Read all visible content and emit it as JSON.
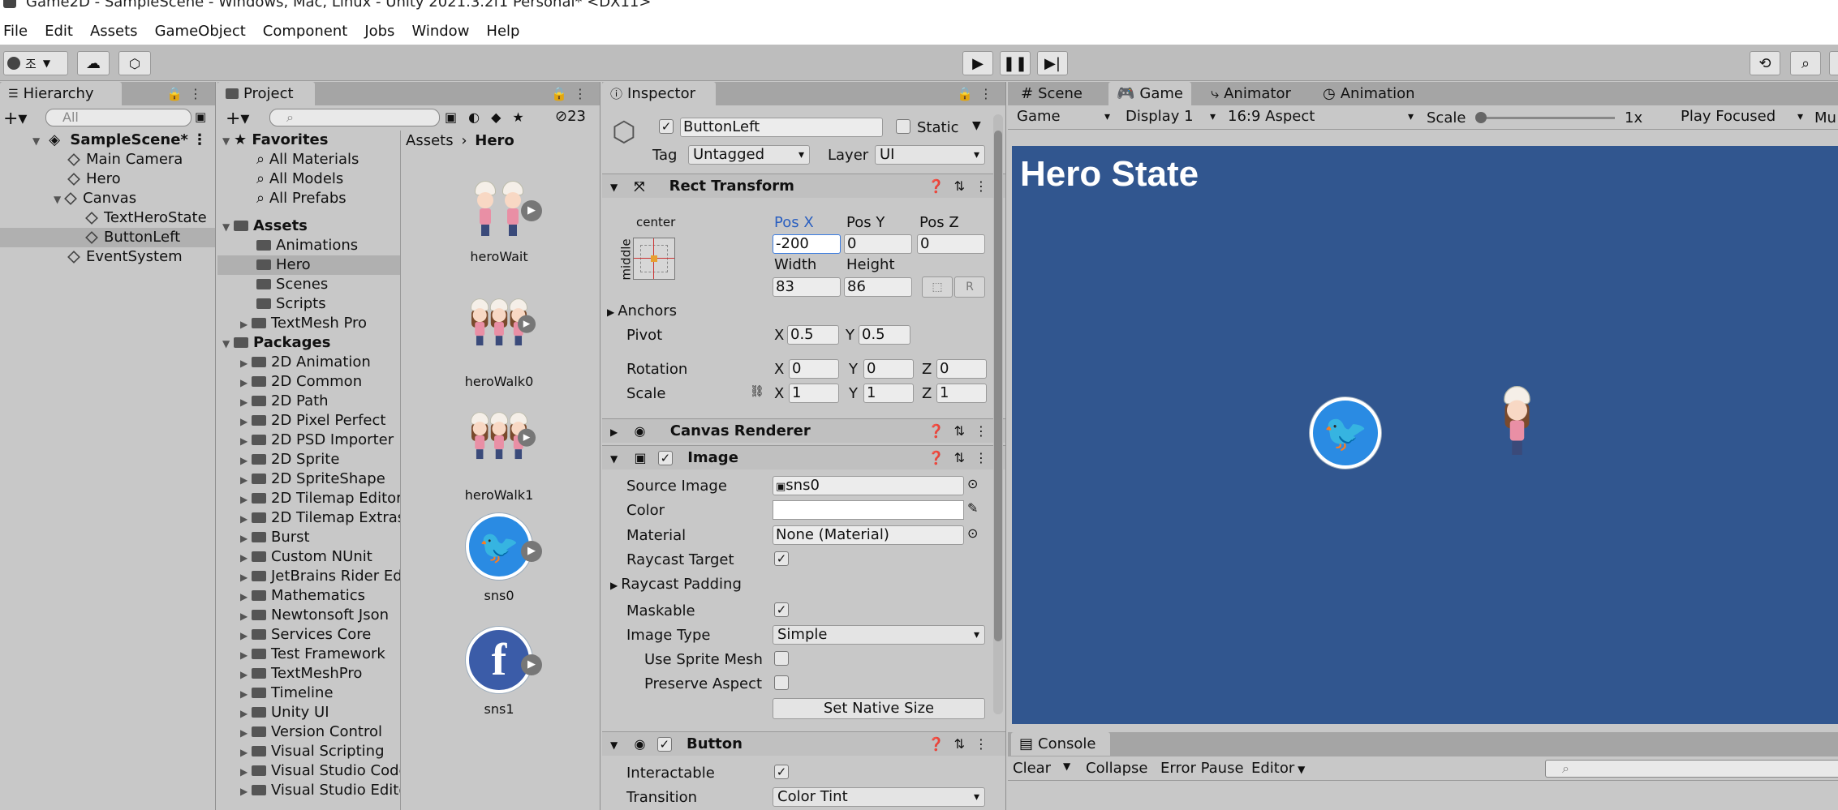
{
  "window": {
    "title": "Game2D - SampleScene - Windows, Mac, Linux - Unity 2021.3.2f1 Personal* <DX11>"
  },
  "menu": [
    "File",
    "Edit",
    "Assets",
    "GameObject",
    "Component",
    "Jobs",
    "Window",
    "Help"
  ],
  "toolbar": {
    "account_label": "조"
  },
  "hierarchy": {
    "tab": "Hierarchy",
    "search_placeholder": "All",
    "scene": "SampleScene*",
    "items": [
      "Main Camera",
      "Hero",
      "Canvas",
      "TextHeroState",
      "ButtonLeft",
      "EventSystem"
    ]
  },
  "project": {
    "tab": "Project",
    "hidden_count": "23",
    "favorites": {
      "title": "Favorites",
      "items": [
        "All Materials",
        "All Models",
        "All Prefabs"
      ]
    },
    "assets": {
      "title": "Assets",
      "items": [
        "Animations",
        "Hero",
        "Scenes",
        "Scripts",
        "TextMesh Pro"
      ]
    },
    "packages": {
      "title": "Packages",
      "items": [
        "2D Animation",
        "2D Common",
        "2D Path",
        "2D Pixel Perfect",
        "2D PSD Importer",
        "2D Sprite",
        "2D SpriteShape",
        "2D Tilemap Editor",
        "2D Tilemap Extras",
        "Burst",
        "Custom NUnit",
        "JetBrains Rider Editor",
        "Mathematics",
        "Newtonsoft Json",
        "Services Core",
        "Test Framework",
        "TextMeshPro",
        "Timeline",
        "Unity UI",
        "Version Control",
        "Visual Scripting",
        "Visual Studio Code Editor",
        "Visual Studio Editor"
      ]
    },
    "breadcrumb": [
      "Assets",
      "Hero"
    ],
    "grid": [
      "heroWait",
      "heroWalk0",
      "heroWalk1",
      "sns0",
      "sns1"
    ]
  },
  "inspector": {
    "tab": "Inspector",
    "object_name": "ButtonLeft",
    "static_label": "Static",
    "tag_label": "Tag",
    "tag_value": "Untagged",
    "layer_label": "Layer",
    "layer_value": "UI",
    "rect": {
      "title": "Rect Transform",
      "anchor_h": "center",
      "anchor_v": "middle",
      "posx_label": "Pos X",
      "posy_label": "Pos Y",
      "posz_label": "Pos Z",
      "posx": "-200",
      "posy": "0",
      "posz": "0",
      "width_label": "Width",
      "height_label": "Height",
      "width": "83",
      "height": "86",
      "anchors": "Anchors",
      "pivot_label": "Pivot",
      "pivot_x": "0.5",
      "pivot_y": "0.5",
      "rotation_label": "Rotation",
      "rot_x": "0",
      "rot_y": "0",
      "rot_z": "0",
      "scale_label": "Scale",
      "scale_x": "1",
      "scale_y": "1",
      "scale_z": "1",
      "x": "X",
      "y": "Y",
      "z": "Z"
    },
    "canvas_renderer": "Canvas Renderer",
    "image": {
      "title": "Image",
      "source_label": "Source Image",
      "source_value": "sns0",
      "color_label": "Color",
      "material_label": "Material",
      "material_value": "None (Material)",
      "raycast_label": "Raycast Target",
      "raycast_padding": "Raycast Padding",
      "maskable_label": "Maskable",
      "image_type_label": "Image Type",
      "image_type_value": "Simple",
      "sprite_mesh_label": "Use Sprite Mesh",
      "preserve_label": "Preserve Aspect",
      "native_size": "Set Native Size"
    },
    "button": {
      "title": "Button",
      "interactable_label": "Interactable",
      "transition_label": "Transition",
      "transition_value": "Color Tint"
    }
  },
  "viewtabs": [
    "Scene",
    "Game",
    "Animator",
    "Animation"
  ],
  "game": {
    "mode": "Game",
    "display": "Display 1",
    "aspect": "16:9 Aspect",
    "scale_label": "Scale",
    "scale_value": "1x",
    "play_focus": "Play Focused",
    "more": "Mu",
    "title": "Hero State"
  },
  "console": {
    "tab": "Console",
    "clear": "Clear",
    "collapse": "Collapse",
    "error_pause": "Error Pause",
    "editor": "Editor"
  },
  "colors": {
    "game_bg": "#31568f",
    "selection": "#b0b0b0",
    "twitter": "#2a8be3",
    "facebook": "#3b5ca8"
  }
}
